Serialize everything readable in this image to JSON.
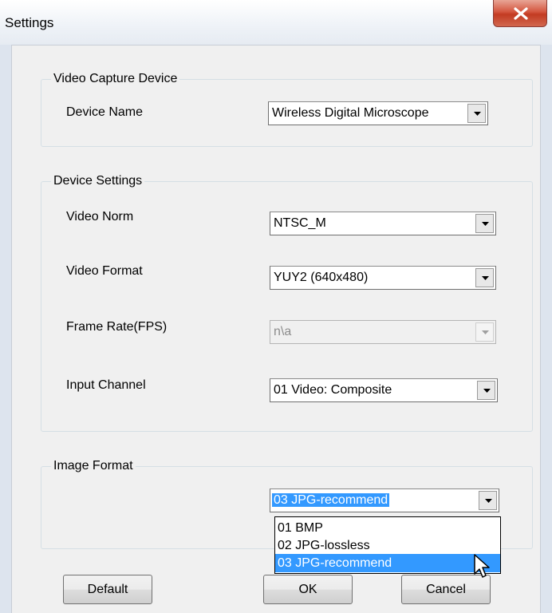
{
  "window": {
    "title": "Settings"
  },
  "groups": {
    "capture": {
      "label": "Video Capture Device"
    },
    "device_settings": {
      "label": "Device Settings"
    },
    "image_format": {
      "label": "Image Format"
    }
  },
  "fields": {
    "device_name": {
      "label": "Device Name",
      "value": "Wireless Digital Microscope"
    },
    "video_norm": {
      "label": "Video Norm",
      "value": "NTSC_M"
    },
    "video_format": {
      "label": "Video Format",
      "value": "YUY2 (640x480)"
    },
    "frame_rate": {
      "label": "Frame Rate(FPS)",
      "value": "n\\a"
    },
    "input_channel": {
      "label": "Input Channel",
      "value": "01 Video: Composite"
    },
    "image_format": {
      "value": "03 JPG-recommend"
    }
  },
  "image_format_options": [
    "01 BMP",
    "02 JPG-lossless",
    "03 JPG-recommend"
  ],
  "buttons": {
    "default": "Default",
    "ok": "OK",
    "cancel": "Cancel"
  },
  "colors": {
    "selection": "#3399ff",
    "close_button": "#c23b22"
  },
  "icons": {
    "close": "close-icon",
    "dropdown": "chevron-down-icon",
    "cursor": "mouse-pointer-icon"
  }
}
